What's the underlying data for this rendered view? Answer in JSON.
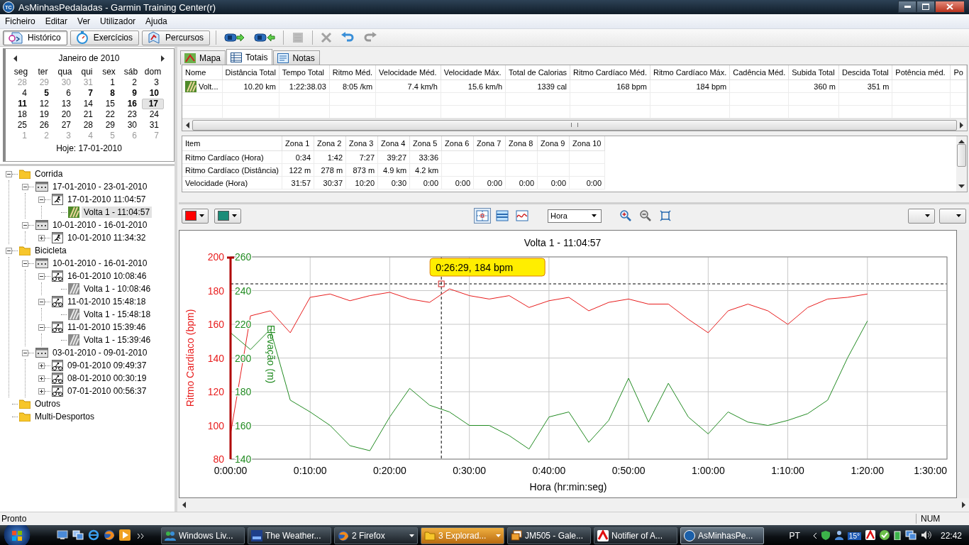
{
  "window": {
    "title": "AsMinhasPedaladas - Garmin Training Center(r)",
    "icon_label": "TC"
  },
  "menu": [
    "Ficheiro",
    "Editar",
    "Ver",
    "Utilizador",
    "Ajuda"
  ],
  "toolbar": {
    "views": [
      {
        "kind": "history",
        "label": "Histórico",
        "selected": true
      },
      {
        "kind": "workouts",
        "label": "Exercícios",
        "selected": false
      },
      {
        "kind": "courses",
        "label": "Percursos",
        "selected": false
      }
    ],
    "actions": [
      {
        "kind": "send",
        "disabled": false
      },
      {
        "kind": "receive",
        "disabled": false
      },
      {
        "kind": "new",
        "disabled": true
      },
      {
        "kind": "delete",
        "disabled": true
      },
      {
        "kind": "undo",
        "disabled": false
      },
      {
        "kind": "redo",
        "disabled": true
      }
    ]
  },
  "calendar": {
    "month": "Janeiro de 2010",
    "weekdays": [
      "seg",
      "ter",
      "qua",
      "qui",
      "sex",
      "sáb",
      "dom"
    ],
    "today": "Hoje: 17-01-2010",
    "weeks": [
      [
        {
          "day": "28",
          "other": true,
          "bold": false,
          "selected": false
        },
        {
          "day": "29",
          "other": true,
          "bold": false,
          "selected": false
        },
        {
          "day": "30",
          "other": true,
          "bold": false,
          "selected": false
        },
        {
          "day": "31",
          "other": true,
          "bold": false,
          "selected": false
        },
        {
          "day": "1",
          "other": false,
          "bold": false,
          "selected": false
        },
        {
          "day": "2",
          "other": false,
          "bold": false,
          "selected": false
        },
        {
          "day": "3",
          "other": false,
          "bold": false,
          "selected": false
        }
      ],
      [
        {
          "day": "4",
          "other": false,
          "bold": false,
          "selected": false
        },
        {
          "day": "5",
          "other": false,
          "bold": true,
          "selected": false
        },
        {
          "day": "6",
          "other": false,
          "bold": false,
          "selected": false
        },
        {
          "day": "7",
          "other": false,
          "bold": true,
          "selected": false
        },
        {
          "day": "8",
          "other": false,
          "bold": true,
          "selected": false
        },
        {
          "day": "9",
          "other": false,
          "bold": true,
          "selected": false
        },
        {
          "day": "10",
          "other": false,
          "bold": true,
          "selected": false
        }
      ],
      [
        {
          "day": "11",
          "other": false,
          "bold": true,
          "selected": false
        },
        {
          "day": "12",
          "other": false,
          "bold": false,
          "selected": false
        },
        {
          "day": "13",
          "other": false,
          "bold": false,
          "selected": false
        },
        {
          "day": "14",
          "other": false,
          "bold": false,
          "selected": false
        },
        {
          "day": "15",
          "other": false,
          "bold": false,
          "selected": false
        },
        {
          "day": "16",
          "other": false,
          "bold": true,
          "selected": false
        },
        {
          "day": "17",
          "other": false,
          "bold": true,
          "selected": true
        }
      ],
      [
        {
          "day": "18",
          "other": false,
          "bold": false,
          "selected": false
        },
        {
          "day": "19",
          "other": false,
          "bold": false,
          "selected": false
        },
        {
          "day": "20",
          "other": false,
          "bold": false,
          "selected": false
        },
        {
          "day": "21",
          "other": false,
          "bold": false,
          "selected": false
        },
        {
          "day": "22",
          "other": false,
          "bold": false,
          "selected": false
        },
        {
          "day": "23",
          "other": false,
          "bold": false,
          "selected": false
        },
        {
          "day": "24",
          "other": false,
          "bold": false,
          "selected": false
        }
      ],
      [
        {
          "day": "25",
          "other": false,
          "bold": false,
          "selected": false
        },
        {
          "day": "26",
          "other": false,
          "bold": false,
          "selected": false
        },
        {
          "day": "27",
          "other": false,
          "bold": false,
          "selected": false
        },
        {
          "day": "28",
          "other": false,
          "bold": false,
          "selected": false
        },
        {
          "day": "29",
          "other": false,
          "bold": false,
          "selected": false
        },
        {
          "day": "30",
          "other": false,
          "bold": false,
          "selected": false
        },
        {
          "day": "31",
          "other": false,
          "bold": false,
          "selected": false
        }
      ],
      [
        {
          "day": "1",
          "other": true,
          "bold": false,
          "selected": false
        },
        {
          "day": "2",
          "other": true,
          "bold": false,
          "selected": false
        },
        {
          "day": "3",
          "other": true,
          "bold": false,
          "selected": false
        },
        {
          "day": "4",
          "other": true,
          "bold": false,
          "selected": false
        },
        {
          "day": "5",
          "other": true,
          "bold": false,
          "selected": false
        },
        {
          "day": "6",
          "other": true,
          "bold": false,
          "selected": false
        },
        {
          "day": "7",
          "other": true,
          "bold": false,
          "selected": false
        }
      ]
    ]
  },
  "tree": [
    {
      "kind": "folder",
      "label": "Corrida",
      "expanded": true,
      "selected": false,
      "children": [
        {
          "kind": "week",
          "label": "17-01-2010 - 23-01-2010",
          "expanded": true,
          "selected": false,
          "children": [
            {
              "kind": "run",
              "label": "17-01-2010 11:04:57",
              "expanded": true,
              "selected": false,
              "children": [
                {
                  "kind": "run-lap",
                  "label": "Volta 1 - 11:04:57",
                  "selected": true
                }
              ]
            }
          ]
        },
        {
          "kind": "week",
          "label": "10-01-2010 - 16-01-2010",
          "expanded": true,
          "selected": false,
          "children": [
            {
              "kind": "run",
              "label": "10-01-2010 11:34:32",
              "expanded": false,
              "selected": false
            }
          ]
        }
      ]
    },
    {
      "kind": "folder",
      "label": "Bicicleta",
      "expanded": true,
      "selected": false,
      "children": [
        {
          "kind": "week",
          "label": "10-01-2010 - 16-01-2010",
          "expanded": true,
          "selected": false,
          "children": [
            {
              "kind": "bike",
              "label": "16-01-2010 10:08:46",
              "expanded": true,
              "selected": false,
              "children": [
                {
                  "kind": "bike-lap",
                  "label": "Volta 1 - 10:08:46",
                  "selected": false
                }
              ]
            },
            {
              "kind": "bike",
              "label": "11-01-2010 15:48:18",
              "expanded": true,
              "selected": false,
              "children": [
                {
                  "kind": "bike-lap",
                  "label": "Volta 1 - 15:48:18",
                  "selected": false
                }
              ]
            },
            {
              "kind": "bike",
              "label": "11-01-2010 15:39:46",
              "expanded": true,
              "selected": false,
              "children": [
                {
                  "kind": "bike-lap",
                  "label": "Volta 1 - 15:39:46",
                  "selected": false
                }
              ]
            }
          ]
        },
        {
          "kind": "week",
          "label": "03-01-2010 - 09-01-2010",
          "expanded": true,
          "selected": false,
          "children": [
            {
              "kind": "bike",
              "label": "09-01-2010 09:49:37",
              "expanded": false,
              "selected": false
            },
            {
              "kind": "bike",
              "label": "08-01-2010 00:30:19",
              "expanded": false,
              "selected": false
            },
            {
              "kind": "bike",
              "label": "07-01-2010 00:56:37",
              "expanded": false,
              "selected": false
            }
          ]
        }
      ]
    },
    {
      "kind": "folder",
      "label": "Outros",
      "selected": false
    },
    {
      "kind": "folder",
      "label": "Multi-Desportos",
      "selected": false
    }
  ],
  "tabs": [
    {
      "kind": "map",
      "label": "Mapa",
      "selected": false
    },
    {
      "kind": "totals",
      "label": "Totais",
      "selected": true
    },
    {
      "kind": "notes",
      "label": "Notas",
      "selected": false
    }
  ],
  "totals": {
    "columns": [
      "Nome",
      "Distância Total",
      "Tempo Total",
      "Ritmo Méd.",
      "Velocidade Méd.",
      "Velocidade Máx.",
      "Total de Calorias",
      "Ritmo Cardíaco Méd.",
      "Ritmo Cardíaco Máx.",
      "Cadência Méd.",
      "Subida Total",
      "Descida Total",
      "Potência méd.",
      "Po"
    ],
    "rows": [
      {
        "kind": "run-lap",
        "cells": [
          "Volt...",
          "10.20 km",
          "1:22:38.03",
          "8:05 /km",
          "7.4 km/h",
          "15.6 km/h",
          "1339 cal",
          "168 bpm",
          "184 bpm",
          null,
          "360 m",
          "351 m",
          null,
          null
        ]
      }
    ]
  },
  "zones": {
    "columns": [
      "Item",
      "Zona 1",
      "Zona 2",
      "Zona 3",
      "Zona 4",
      "Zona 5",
      "Zona 6",
      "Zona 7",
      "Zona 8",
      "Zona 9",
      "Zona 10"
    ],
    "rows": [
      [
        "Ritmo Cardíaco (Hora)",
        "0:34",
        "1:42",
        "7:27",
        "39:27",
        "33:36",
        null,
        null,
        null,
        null,
        null
      ],
      [
        "Ritmo Cardíaco (Distância)",
        "122 m",
        "278 m",
        "873 m",
        "4.9 km",
        "4.2 km",
        null,
        null,
        null,
        null,
        null
      ],
      [
        "Velocidade (Hora)",
        "31:57",
        "30:37",
        "10:20",
        "0:30",
        "0:00",
        "0:00",
        "0:00",
        "0:00",
        "0:00",
        "0:00"
      ]
    ]
  },
  "chart_toolbar": {
    "series_colors": [
      {
        "color": "#ff0000"
      },
      {
        "color": "#1b8c78"
      }
    ],
    "modes": [
      {
        "kind": "crosshair",
        "selected": true
      },
      {
        "kind": "bands",
        "selected": false
      },
      {
        "kind": "curve",
        "selected": false
      }
    ],
    "x_axis": "Hora"
  },
  "chart": {
    "chart_data": {
      "type": "line",
      "title": "Volta 1 - 11:04:57",
      "xlabel": "Hora (hr:min:seg)",
      "ylabel": "Ritmo Cardíaco (bpm)",
      "y2label": "Elevação (m)",
      "x": [
        0,
        2.5,
        5,
        7.5,
        10,
        12.5,
        15,
        17.5,
        20,
        22.5,
        25,
        27.5,
        30,
        32.5,
        35,
        37.5,
        40,
        42.5,
        45,
        47.5,
        50,
        52.5,
        55,
        57.5,
        60,
        62.5,
        65,
        67.5,
        70,
        72.5,
        75,
        77.5,
        80
      ],
      "series": [
        {
          "color": "#e81c1c",
          "values": [
            95,
            165,
            168,
            155,
            176,
            178,
            174,
            177,
            179,
            175,
            173,
            181,
            177,
            175,
            177,
            170,
            174,
            176,
            168,
            173,
            175,
            172,
            172,
            163,
            155,
            168,
            172,
            168,
            160,
            170,
            175,
            176,
            178
          ]
        },
        {
          "color": "#228b22",
          "axis": "y2",
          "values": [
            215,
            205,
            217,
            175,
            168,
            160,
            148,
            145,
            165,
            182,
            172,
            168,
            160,
            160,
            154,
            146,
            165,
            168,
            150,
            163,
            188,
            162,
            185,
            165,
            155,
            168,
            162,
            160,
            163,
            167,
            175,
            200,
            222
          ]
        }
      ],
      "xlim": [
        0,
        90
      ],
      "ylim": [
        80,
        200
      ],
      "y2lim": [
        140,
        260
      ],
      "xticks": [
        {
          "value": 0,
          "label": "0:00:00"
        },
        {
          "value": 10,
          "label": "0:10:00"
        },
        {
          "value": 20,
          "label": "0:20:00"
        },
        {
          "value": 30,
          "label": "0:30:00"
        },
        {
          "value": 40,
          "label": "0:40:00"
        },
        {
          "value": 50,
          "label": "0:50:00"
        },
        {
          "value": 60,
          "label": "1:00:00"
        },
        {
          "value": 70,
          "label": "1:10:00"
        },
        {
          "value": 80,
          "label": "1:20:00"
        },
        {
          "value": 90,
          "label": "1:30:00"
        }
      ],
      "yticks": [
        80,
        100,
        120,
        140,
        160,
        180,
        200
      ],
      "y2ticks": [
        140,
        160,
        180,
        200,
        220,
        240,
        260
      ],
      "grid": true,
      "ref_lines": [
        {
          "axis": "x",
          "value": 26.48
        },
        {
          "axis": "y",
          "value": 184
        }
      ],
      "annotations": [
        {
          "x": 26.48,
          "y": 184,
          "text": "0:26:29, 184 bpm"
        }
      ]
    }
  },
  "status_bar": {
    "text": "Pronto",
    "indicator": "NUM"
  },
  "taskbar": {
    "tasks": [
      {
        "kind": "messenger",
        "label": "Windows Liv...",
        "grouped": false,
        "flashing": false,
        "selected": false
      },
      {
        "kind": "weather",
        "label": "The Weather...",
        "grouped": false,
        "flashing": false,
        "selected": false
      },
      {
        "kind": "browser",
        "label": "2 Firefox",
        "grouped": true,
        "flashing": false,
        "selected": false
      },
      {
        "kind": "explorer",
        "label": "3 Explorad...",
        "grouped": true,
        "flashing": true,
        "selected": false
      },
      {
        "kind": "gallery",
        "label": "JM505 - Gale...",
        "grouped": false,
        "flashing": false,
        "selected": false
      },
      {
        "kind": "notifier",
        "label": "Notifier of A...",
        "grouped": false,
        "flashing": false,
        "selected": false
      },
      {
        "kind": "app",
        "label": "AsMinhasPe...",
        "grouped": false,
        "flashing": false,
        "selected": true
      }
    ],
    "language": "PT",
    "temperature": "15°",
    "clock": "22:42"
  }
}
